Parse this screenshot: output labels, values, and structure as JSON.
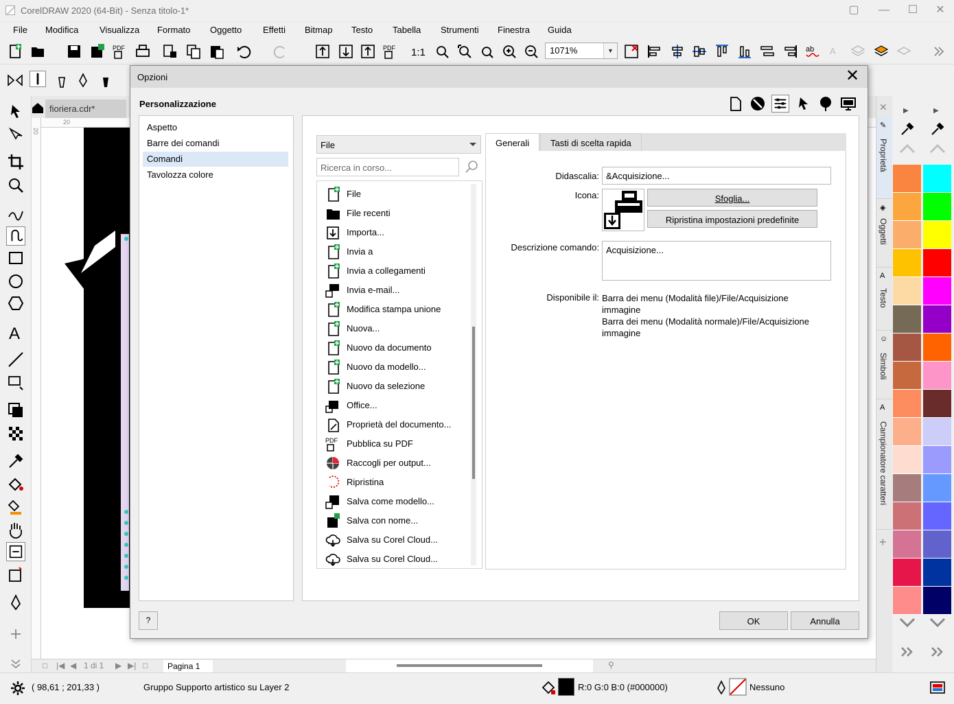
{
  "window": {
    "title": "CorelDRAW 2020 (64-Bit) - Senza titolo-1*"
  },
  "menu": [
    "File",
    "Modifica",
    "Visualizza",
    "Formato",
    "Oggetto",
    "Effetti",
    "Bitmap",
    "Testo",
    "Tabella",
    "Strumenti",
    "Finestra",
    "Guida"
  ],
  "toolbar": {
    "zoom": "1071%"
  },
  "document": {
    "tab": "fioriera.cdr*",
    "ruler_h_mark": "20",
    "ruler_v_mark": "20",
    "page_nav": "1 di 1",
    "page_tab": "Pagina 1"
  },
  "dockers": [
    "Proprietà",
    "Oggetti",
    "Testo",
    "Simboli",
    "Campionatore caratteri"
  ],
  "palette_left": [
    "#FA8540",
    "#FBA63F",
    "#FBAE6C",
    "#FFC200",
    "#FDDAA4",
    "#756A56",
    "#A65744",
    "#C6693E",
    "#FD8C5E",
    "#FDAE8A",
    "#FEDDD0",
    "#A67C7C",
    "#CC7176",
    "#D47394",
    "#E6154A",
    "#FD8C8A"
  ],
  "palette_right": [
    "#00FFFF",
    "#00FF00",
    "#FFFF00",
    "#FF0000",
    "#FF00FF",
    "#9400C8",
    "#FE6300",
    "#FE95C8",
    "#6A2B2B",
    "#CDCDFA",
    "#9B9BFE",
    "#6699FF",
    "#6565FF",
    "#6262CC",
    "#0033A0",
    "#000066"
  ],
  "status": {
    "coords": "( 98,61 ; 201,33 )",
    "info": "Gruppo Supporto artistico su Layer 2",
    "fill": "R:0 G:0 B:0 (#000000)",
    "outline": "Nessuno"
  },
  "dialog": {
    "title": "Opzioni",
    "heading": "Personalizzazione",
    "tree": [
      "Aspetto",
      "Barre dei comandi",
      "Comandi",
      "Tavolozza colore"
    ],
    "tree_selected": 2,
    "category": "File",
    "search_placeholder": "Ricerca in corso...",
    "commands": [
      {
        "icon": "new-page-icon",
        "label": "File"
      },
      {
        "icon": "folder-icon",
        "label": "File recenti"
      },
      {
        "icon": "import-icon",
        "label": "Importa..."
      },
      {
        "icon": "send-icon",
        "label": "Invia a"
      },
      {
        "icon": "send-link-icon",
        "label": "Invia a collegamenti"
      },
      {
        "icon": "email-icon",
        "label": "Invia e-mail..."
      },
      {
        "icon": "merge-icon",
        "label": "Modifica stampa unione"
      },
      {
        "icon": "new-icon",
        "label": "Nuova..."
      },
      {
        "icon": "new-from-doc-icon",
        "label": "Nuovo da documento"
      },
      {
        "icon": "new-from-template-icon",
        "label": "Nuovo da modello..."
      },
      {
        "icon": "new-from-selection-icon",
        "label": "Nuovo da selezione"
      },
      {
        "icon": "office-icon",
        "label": "Office..."
      },
      {
        "icon": "doc-properties-icon",
        "label": "Proprietà del documento..."
      },
      {
        "icon": "pdf-icon",
        "label": "Pubblica su PDF"
      },
      {
        "icon": "collect-output-icon",
        "label": "Raccogli per output..."
      },
      {
        "icon": "revert-icon",
        "label": "Ripristina"
      },
      {
        "icon": "save-template-icon",
        "label": "Salva come modello..."
      },
      {
        "icon": "save-as-icon",
        "label": "Salva con nome..."
      },
      {
        "icon": "cloud-icon",
        "label": "Salva su Corel Cloud..."
      },
      {
        "icon": "cloud-icon",
        "label": "Salva su Corel Cloud..."
      }
    ],
    "tabs": [
      "Generali",
      "Tasti di scelta rapida"
    ],
    "general": {
      "caption_label": "Didascalia:",
      "caption_value": "&Acquisizione...",
      "icon_label": "Icona:",
      "browse_button": "Sfoglia...",
      "reset_button": "Ripristina impostazioni predefinite",
      "description_label": "Descrizione comando:",
      "description_value": "Acquisizione...",
      "available_label": "Disponibile il:",
      "available_lines": [
        "Barra dei menu (Modalità file)/File/Acquisizione",
        "immagine",
        "Barra dei menu (Modalità normale)/File/Acquisizione",
        "immagine"
      ]
    },
    "help_button": "?",
    "ok_button": "OK",
    "cancel_button": "Annulla"
  }
}
